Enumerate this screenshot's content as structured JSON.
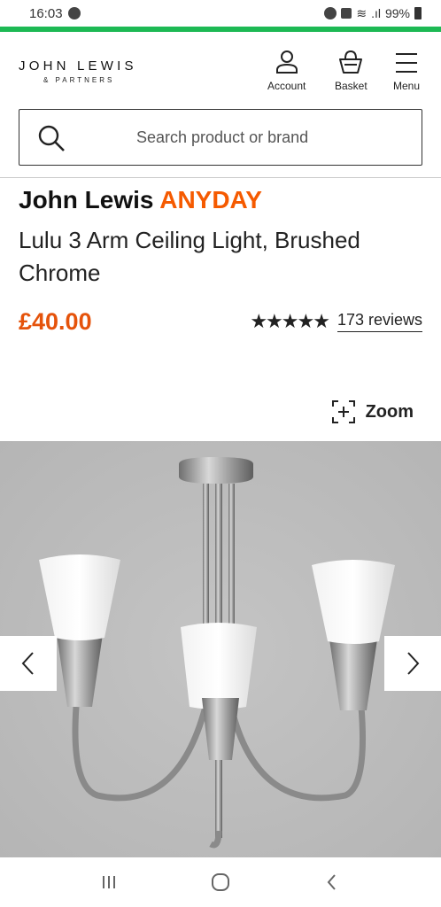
{
  "status_bar": {
    "time": "16:03",
    "battery": "99%"
  },
  "header": {
    "logo_main": "JOHN LEWIS",
    "logo_sub": "& PARTNERS",
    "account_label": "Account",
    "basket_label": "Basket",
    "menu_label": "Menu"
  },
  "search": {
    "placeholder": "Search product or brand"
  },
  "product": {
    "brand_name": "John Lewis",
    "brand_range": "ANYDAY",
    "title": "Lulu 3 Arm Ceiling Light, Brushed Chrome",
    "price": "£40.00",
    "rating": 5,
    "stars": "★★★★★",
    "reviews_label": "173 reviews",
    "zoom_label": "Zoom"
  },
  "colors": {
    "accent": "#e5530b",
    "brand_green": "#1db954"
  },
  "icons": [
    "account-icon",
    "basket-icon",
    "menu-icon",
    "search-icon",
    "zoom-icon",
    "chevron-left-icon",
    "chevron-right-icon"
  ]
}
